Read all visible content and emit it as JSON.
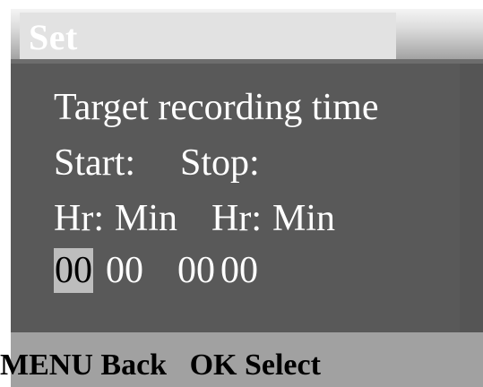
{
  "header": {
    "title": "Set"
  },
  "panel": {
    "heading": "Target recording time",
    "start_label": "Start:",
    "stop_label": "Stop:",
    "start_hr_label": "Hr:",
    "start_min_label": "Min",
    "stop_hr_label": "Hr:",
    "stop_min_label": "Min",
    "start_hr_value": "00",
    "start_min_value": "00",
    "stop_hr_value": "00",
    "stop_min_value": "00",
    "selected_field": "start_hr_value"
  },
  "footer": {
    "menu_key": "MENU",
    "menu_action": "Back",
    "ok_key": "OK",
    "ok_action": "Select"
  },
  "colors": {
    "panel_bg": "#595959",
    "footer_bg": "#a1a1a1",
    "selection_bg": "#bdbdbd",
    "text": "#ffffff"
  }
}
